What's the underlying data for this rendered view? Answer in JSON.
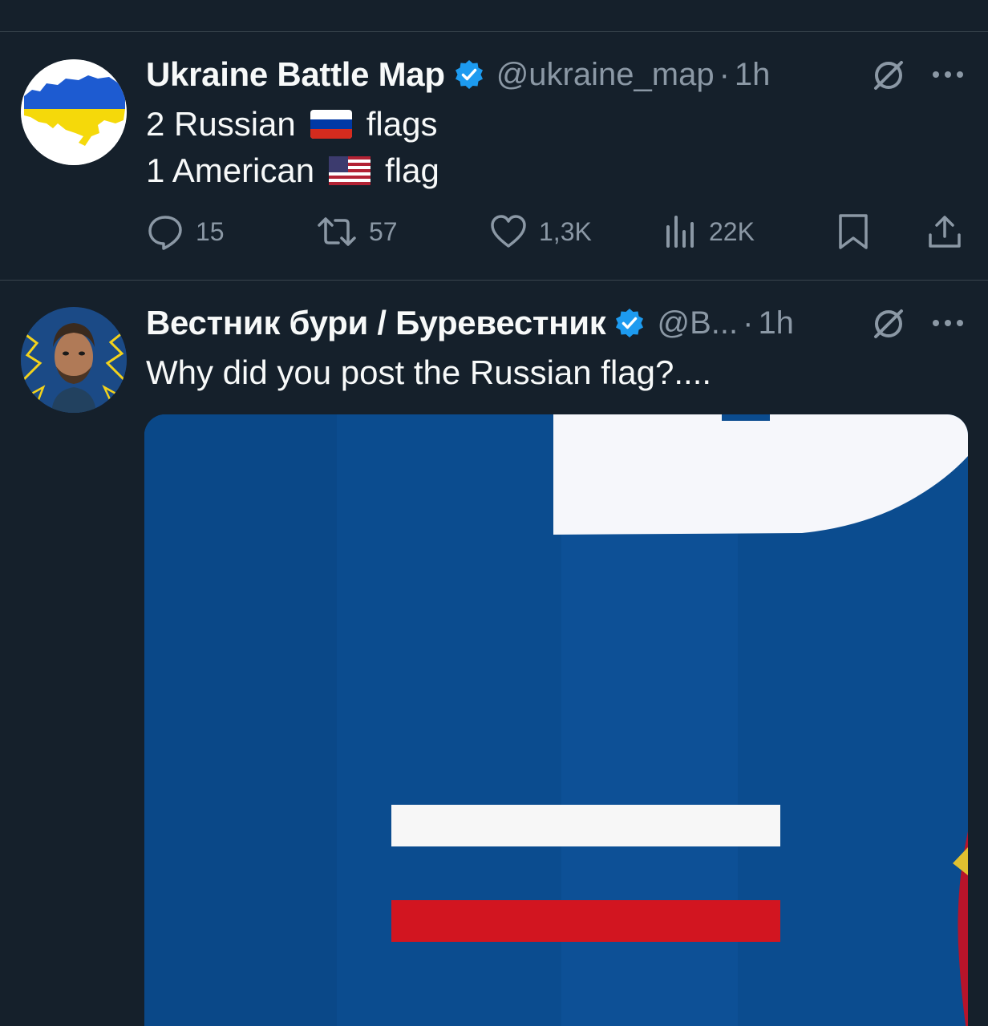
{
  "tweets": [
    {
      "display_name": "Ukraine Battle Map",
      "handle": "@ukraine_map",
      "separator": "·",
      "time": "1h",
      "lines": [
        {
          "prefix": "2 Russian",
          "flag": "russia-flag-emoji",
          "suffix": "flags"
        },
        {
          "prefix": "1 American",
          "flag": "us-flag-emoji",
          "suffix": "flag"
        }
      ],
      "actions": {
        "replies": "15",
        "reposts": "57",
        "likes": "1,3K",
        "views": "22K"
      },
      "avatar": "ukraine-map-avatar",
      "verified": true
    },
    {
      "display_name": "Вестник бури / Буревестник",
      "handle": "@B...",
      "separator": "·",
      "time": "1h",
      "text": "Why did you post the Russian flag?....",
      "avatar": "man-portrait-avatar",
      "verified": true,
      "media": "zoomed-russian-flag-image"
    }
  ],
  "colors": {
    "background": "#15202b",
    "divider": "#38444d",
    "secondary_text": "#8b98a5",
    "verified_blue": "#1d9bf0"
  }
}
